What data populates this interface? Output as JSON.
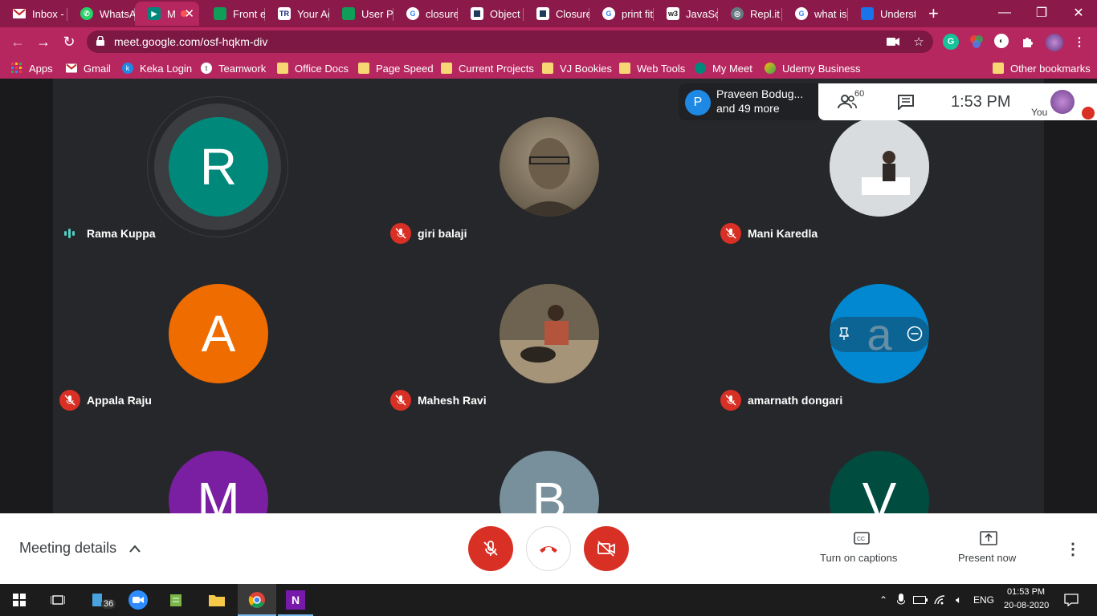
{
  "browser": {
    "tabs": [
      {
        "label": "Inbox -",
        "icon": "gmail-icon",
        "color": "#c5221f"
      },
      {
        "label": "WhatsA",
        "icon": "whatsapp-icon",
        "color": "#25d366"
      },
      {
        "label": "M",
        "icon": "meet-icon",
        "color": "#00897b"
      },
      {
        "label": "Front er",
        "icon": "sheet-icon",
        "color": "#0f9d58"
      },
      {
        "label": "Your Ac",
        "icon": "tr-icon",
        "color": "#1a237e"
      },
      {
        "label": "User Pr",
        "icon": "sheet-icon",
        "color": "#0f9d58"
      },
      {
        "label": "closure",
        "icon": "google-icon",
        "color": "#ffffff"
      },
      {
        "label": "Object",
        "icon": "bookmark-icon",
        "color": "#1e3a5f"
      },
      {
        "label": "Closure",
        "icon": "bookmark-icon",
        "color": "#1e3a5f"
      },
      {
        "label": "print fit",
        "icon": "google-icon",
        "color": "#ffffff"
      },
      {
        "label": "JavaScr",
        "icon": "w3-icon",
        "color": "#ffffff"
      },
      {
        "label": "Repl.it -",
        "icon": "replit-icon",
        "color": "#667881"
      },
      {
        "label": "what is",
        "icon": "google-icon",
        "color": "#ffffff"
      },
      {
        "label": "Underst",
        "icon": "site-icon",
        "color": "#1a73e8"
      }
    ],
    "new_tab": "+",
    "url": "meet.google.com/osf-hqkm-div",
    "accent": "#b7275f"
  },
  "bookmarks": [
    {
      "label": "Apps"
    },
    {
      "label": "Gmail"
    },
    {
      "label": "Keka Login"
    },
    {
      "label": "Teamwork"
    },
    {
      "label": "Office Docs"
    },
    {
      "label": "Page Speed"
    },
    {
      "label": "Current Projects"
    },
    {
      "label": "VJ Bookies"
    },
    {
      "label": "Web Tools"
    },
    {
      "label": "My Meet"
    },
    {
      "label": "Udemy Business"
    },
    {
      "label": "Other bookmarks"
    }
  ],
  "meeting": {
    "presenter_line1": "Praveen Bodug...",
    "presenter_line2": "and 49 more",
    "presenter_initial": "P",
    "participant_count": "60",
    "time": "1:53  PM",
    "you_label": "You"
  },
  "participants": [
    {
      "name": "Rama Kuppa",
      "initial": "R",
      "color": "#00897b",
      "muted": false,
      "speaking": true
    },
    {
      "name": "giri balaji",
      "initial": "",
      "color": "#7d705c",
      "muted": true,
      "photo": true
    },
    {
      "name": "Mani Karedla",
      "initial": "",
      "color": "#c2c7ca",
      "muted": true,
      "photo": true
    },
    {
      "name": "Appala Raju",
      "initial": "A",
      "color": "#ef6c00",
      "muted": true
    },
    {
      "name": "Mahesh Ravi",
      "initial": "",
      "color": "#7a6a52",
      "muted": true,
      "photo": true
    },
    {
      "name": "amarnath dongari",
      "initial": "a",
      "color": "#0288d1",
      "muted": true
    },
    {
      "name": "",
      "initial": "M",
      "color": "#7b1fa2"
    },
    {
      "name": "",
      "initial": "B",
      "color": "#78909c"
    },
    {
      "name": "",
      "initial": "V",
      "color": "#004d40"
    }
  ],
  "controls": {
    "meeting_details": "Meeting details",
    "captions": "Turn on captions",
    "present": "Present now"
  },
  "taskbar": {
    "badge": "36",
    "time": "01:53 PM",
    "date": "20-08-2020",
    "lang": "ENG"
  }
}
